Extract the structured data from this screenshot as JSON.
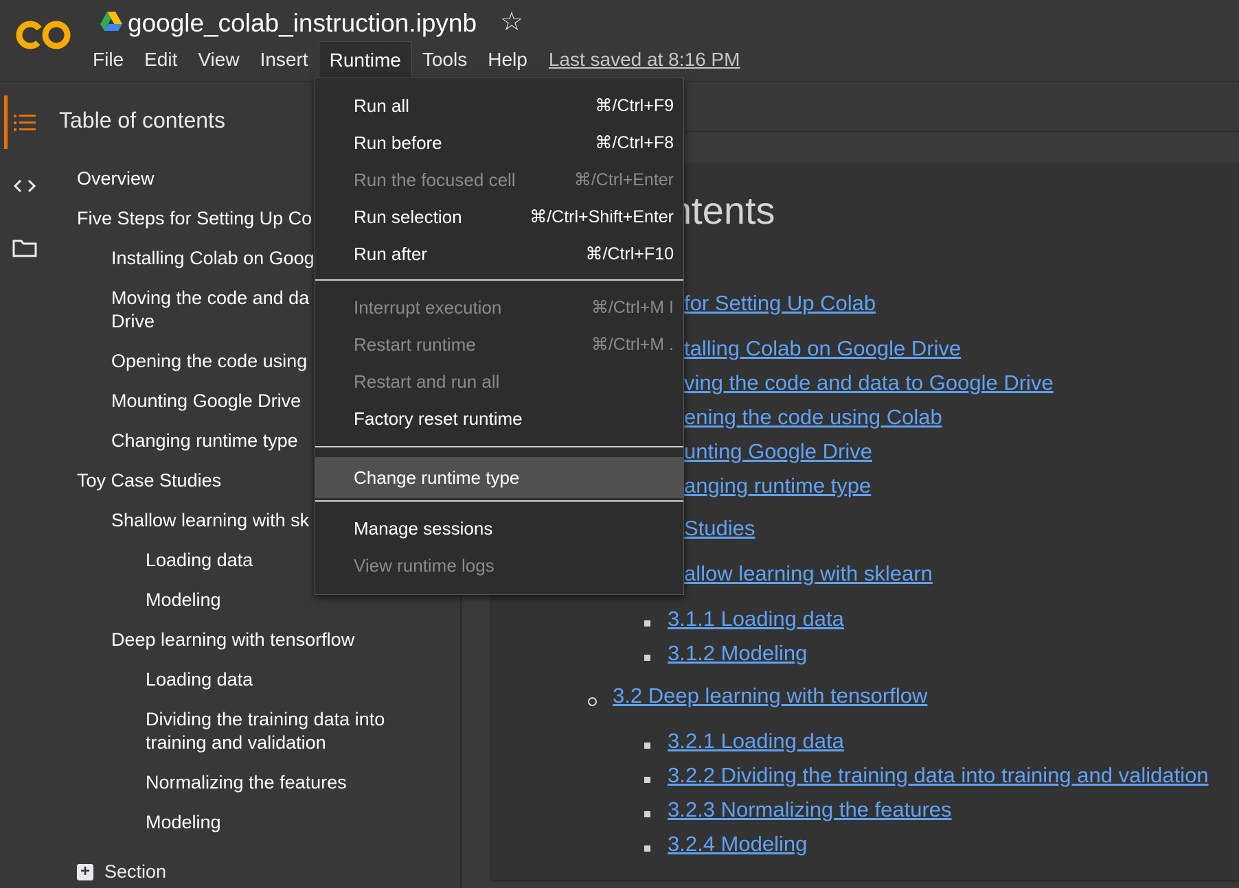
{
  "app": {
    "logo_text": "CO",
    "document_title": "google_colab_instruction.ipynb",
    "last_saved": "Last saved at 8:16 PM",
    "colors": {
      "logo_orange": "#f9ab00",
      "accent": "#e8710a",
      "link": "#5fa2f6",
      "background": "#383838"
    }
  },
  "menu": {
    "items": [
      "File",
      "Edit",
      "View",
      "Insert",
      "Runtime",
      "Tools",
      "Help"
    ],
    "active": "Runtime"
  },
  "icons": {
    "star": "star-icon",
    "toc": "table-of-contents-icon",
    "code": "code-snippets-icon",
    "files": "folder-icon",
    "drive": "google-drive-icon",
    "add_section": "plus-box-icon"
  },
  "runtime_menu": {
    "items": [
      {
        "label": "Run all",
        "shortcut": "⌘/Ctrl+F9",
        "enabled": true
      },
      {
        "label": "Run before",
        "shortcut": "⌘/Ctrl+F8",
        "enabled": true
      },
      {
        "label": "Run the focused cell",
        "shortcut": "⌘/Ctrl+Enter",
        "enabled": false
      },
      {
        "label": "Run selection",
        "shortcut": "⌘/Ctrl+Shift+Enter",
        "enabled": true
      },
      {
        "label": "Run after",
        "shortcut": "⌘/Ctrl+F10",
        "enabled": true
      },
      {
        "label": "Interrupt execution",
        "shortcut": "⌘/Ctrl+M I",
        "enabled": false
      },
      {
        "label": "Restart runtime",
        "shortcut": "⌘/Ctrl+M .",
        "enabled": false
      },
      {
        "label": "Restart and run all",
        "shortcut": "",
        "enabled": false
      },
      {
        "label": "Factory reset runtime",
        "shortcut": "",
        "enabled": true
      },
      {
        "label": "Change runtime type",
        "shortcut": "",
        "enabled": true,
        "highlighted": true
      },
      {
        "label": "Manage sessions",
        "shortcut": "",
        "enabled": true
      },
      {
        "label": "View runtime logs",
        "shortcut": "",
        "enabled": false
      }
    ]
  },
  "toc": {
    "title": "Table of contents",
    "items": [
      {
        "text": "Overview"
      },
      {
        "text": "Five Steps for Setting Up Co"
      },
      {
        "text": "Installing Colab on Goog"
      },
      {
        "text": "Moving the code and da"
      },
      {
        "text": "Drive"
      },
      {
        "text": "Opening the code using"
      },
      {
        "text": "Mounting Google Drive"
      },
      {
        "text": "Changing runtime type"
      },
      {
        "text": "Toy Case Studies"
      },
      {
        "text": "Shallow learning with sk"
      },
      {
        "text": "Loading data"
      },
      {
        "text": "Modeling"
      },
      {
        "text": "Deep learning with tensorflow"
      },
      {
        "text": "Loading data"
      },
      {
        "text": "Dividing the training data into"
      },
      {
        "text": "training and validation"
      },
      {
        "text": "Normalizing the features"
      },
      {
        "text": "Modeling"
      }
    ],
    "add_section_label": "Section"
  },
  "notebook": {
    "heading_visible": "ntents",
    "links": [
      {
        "text": " for Setting Up Colab"
      },
      {
        "text": "talling Colab on Google Drive"
      },
      {
        "text": "ving the code and data to Google Drive"
      },
      {
        "text": "ening the code using Colab"
      },
      {
        "text": "unting Google Drive"
      },
      {
        "text": "anging runtime type"
      },
      {
        "text": "Studies"
      },
      {
        "text": "allow learning with sklearn"
      },
      {
        "text": "3.1.1  Loading data"
      },
      {
        "text": "3.1.2  Modeling"
      },
      {
        "text": "3.2  Deep learning with tensorflow"
      },
      {
        "text": "3.2.1  Loading data"
      },
      {
        "text": "3.2.2  Dividing the training data into training and validation"
      },
      {
        "text": "3.2.3  Normalizing the features"
      },
      {
        "text": "3.2.4  Modeling"
      }
    ]
  }
}
